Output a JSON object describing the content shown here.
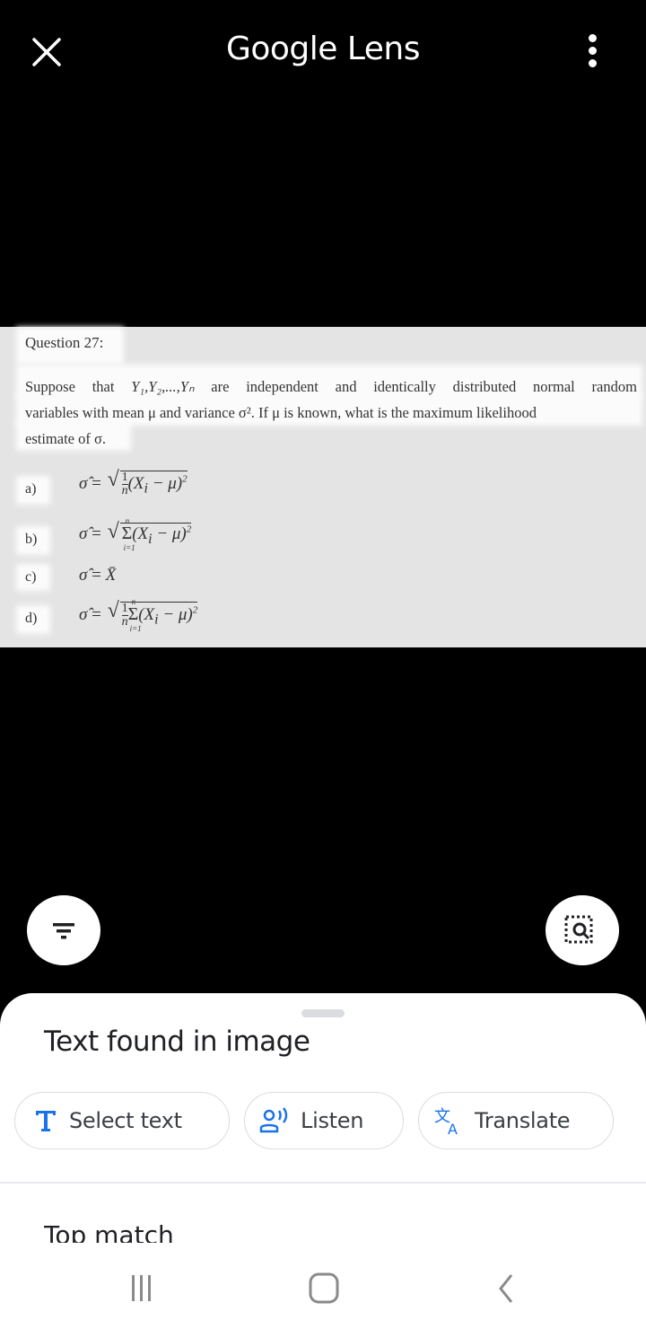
{
  "header": {
    "title": "Google Lens",
    "close_icon": "close-icon",
    "more_icon": "more-vert-icon"
  },
  "document": {
    "question_title": "Question 27:",
    "body_line1_words": [
      "Suppose",
      "that",
      "Y₁,Y₂,...,Yₙ",
      "are",
      "independent",
      "and",
      "identically",
      "distributed",
      "normal",
      "random"
    ],
    "body_line2": "variables with mean μ and variance σ². If μ is known, what is the maximum likelihood",
    "body_line3": "estimate of σ.",
    "options": [
      {
        "label": "a)",
        "formula": "σ̂ = √( (1/n)(Xᵢ − μ)² )"
      },
      {
        "label": "b)",
        "formula": "σ̂ = √( Σᵢ₌₁ⁿ (Xᵢ − μ)² )"
      },
      {
        "label": "c)",
        "formula": "σ̂ = X̄"
      },
      {
        "label": "d)",
        "formula": "σ̂ = √( (1/n) Σᵢ₌₁ⁿ (Xᵢ − μ)² )"
      }
    ],
    "math": {
      "sigma_hat": "σ̂",
      "eq": "=",
      "one": "1",
      "n": "n",
      "i1": "i=1",
      "term": "(X",
      "sub_i": "i",
      "minus_mu": " − μ)",
      "sq": "2",
      "sum": "Σ",
      "xbar": "X̄"
    }
  },
  "fabs": {
    "filter_icon": "filter-icon",
    "search_region_icon": "image-search-icon"
  },
  "sheet": {
    "title": "Text found in image",
    "chips": [
      {
        "label": "Select text",
        "icon": "text-t-icon"
      },
      {
        "label": "Listen",
        "icon": "listen-icon"
      },
      {
        "label": "Translate",
        "icon": "translate-icon"
      }
    ],
    "section_title": "Top match",
    "accent_color": "#1a73e8"
  },
  "navbar": {
    "recents_icon": "recents-icon",
    "home_icon": "home-icon",
    "back_icon": "back-icon"
  }
}
